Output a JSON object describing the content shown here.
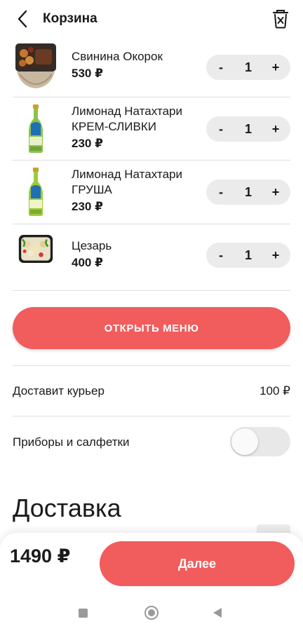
{
  "header": {
    "title": "Корзина"
  },
  "cart": {
    "items": [
      {
        "name": "Свинина Окорок",
        "price": "530 ₽",
        "qty": "1",
        "image": "pork-dish-image"
      },
      {
        "name": "Лимонад Натахтари КРЕМ-СЛИВКИ",
        "price": "230 ₽",
        "qty": "1",
        "image": "lemonade-bottle-image"
      },
      {
        "name": "Лимонад Натахтари ГРУША",
        "price": "230 ₽",
        "qty": "1",
        "image": "lemonade-bottle-image"
      },
      {
        "name": "Цезарь",
        "price": "400 ₽",
        "qty": "1",
        "image": "caesar-salad-image"
      }
    ],
    "minus_label": "-",
    "plus_label": "+"
  },
  "menu_button": {
    "label": "ОТКРЫТЬ МЕНЮ"
  },
  "courier": {
    "label": "Доставит курьер",
    "value": "100 ₽"
  },
  "cutlery": {
    "label": "Приборы и салфетки",
    "enabled": false
  },
  "delivery": {
    "title": "Доставка"
  },
  "footer": {
    "total": "1490 ₽",
    "next_label": "Далее"
  },
  "colors": {
    "accent": "#f15c5c",
    "divider": "#dedede",
    "stepper_bg": "#ebebeb"
  }
}
